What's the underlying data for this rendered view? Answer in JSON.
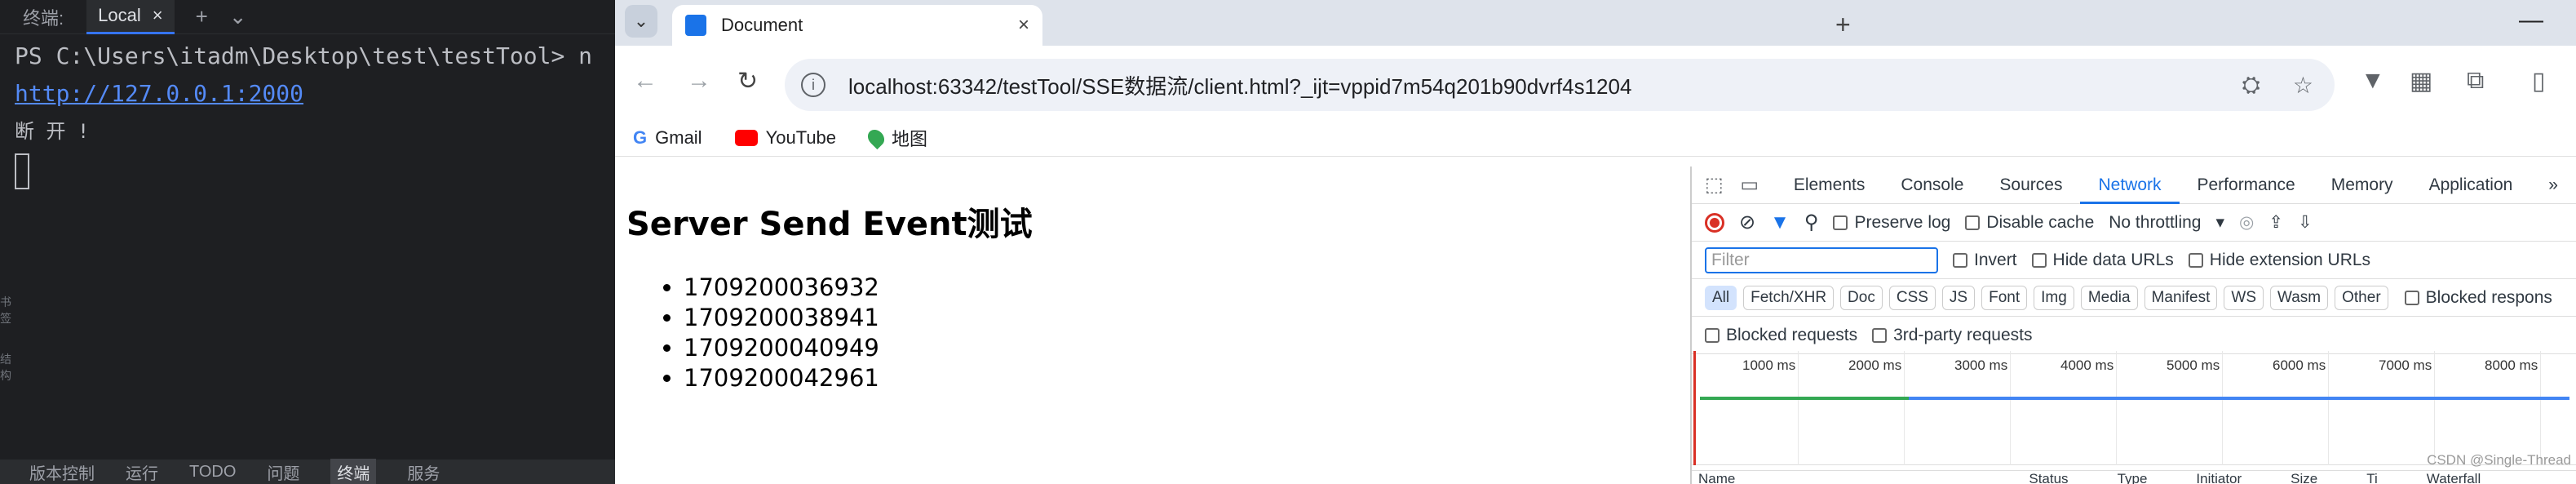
{
  "ide": {
    "terminal_label": "终端:",
    "tab_label": "Local",
    "tab_close": "×",
    "add": "+",
    "dropdown": "⌄",
    "lines": {
      "prompt": "PS C:\\Users\\itadm\\Desktop\\test\\testTool> n",
      "url": "http://127.0.0.1:2000",
      "message": "断 开 !"
    },
    "side": [
      "书签",
      "结构"
    ],
    "status": [
      "版本控制",
      "运行",
      "TODO",
      "问题",
      "终端",
      "服务"
    ]
  },
  "browser": {
    "tab_title": "Document",
    "tab_close": "×",
    "new_tab": "+",
    "minimize": "—",
    "url": "localhost:63342/testTool/SSE数据流/client.html?_ijt=vppid7m54q201b90dvrf4s1204",
    "bookmarks": [
      "Gmail",
      "YouTube",
      "地图"
    ]
  },
  "page": {
    "title": "Server Send Event测试",
    "items": [
      "1709200036932",
      "1709200038941",
      "1709200040949",
      "1709200042961"
    ]
  },
  "devtools": {
    "tabs": [
      "Elements",
      "Console",
      "Sources",
      "Network",
      "Performance",
      "Memory",
      "Application"
    ],
    "more": "»",
    "preserve_log": "Preserve log",
    "disable_cache": "Disable cache",
    "throttling": "No throttling",
    "filter_placeholder": "Filter",
    "invert": "Invert",
    "hide_data_urls": "Hide data URLs",
    "hide_extension_urls": "Hide extension URLs",
    "chips": [
      "All",
      "Fetch/XHR",
      "Doc",
      "CSS",
      "JS",
      "Font",
      "Img",
      "Media",
      "Manifest",
      "WS",
      "Wasm",
      "Other"
    ],
    "blocked_cookies": "Blocked respons",
    "blocked_requests": "Blocked requests",
    "third_party": "3rd-party requests",
    "ticks": [
      "1000 ms",
      "2000 ms",
      "3000 ms",
      "4000 ms",
      "5000 ms",
      "6000 ms",
      "7000 ms",
      "8000 ms"
    ],
    "columns": [
      "Name",
      "Status",
      "Type",
      "Initiator",
      "Size",
      "Ti",
      "Waterfall"
    ],
    "watermark": "CSDN @Single-Thread"
  }
}
